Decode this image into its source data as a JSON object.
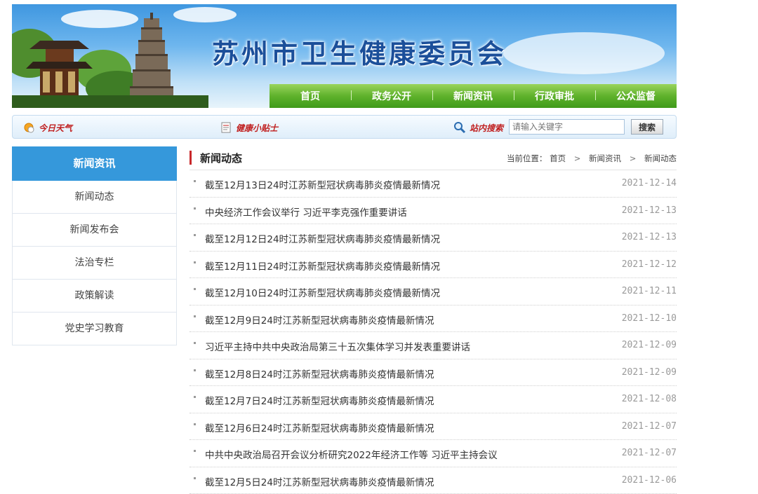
{
  "header": {
    "site_title": "苏州市卫生健康委员会",
    "nav": [
      "首页",
      "政务公开",
      "新闻资讯",
      "行政审批",
      "公众监督"
    ]
  },
  "toolbar": {
    "weather_label": "今日天气",
    "health_tips_label": "健康小贴士",
    "site_search_label": "站内搜索",
    "search_placeholder": "请输入关键字",
    "search_button": "搜索"
  },
  "sidebar": {
    "title": "新闻资讯",
    "items": [
      "新闻动态",
      "新闻发布会",
      "法治专栏",
      "政策解读",
      "党史学习教育"
    ]
  },
  "main": {
    "section_title": "新闻动态",
    "breadcrumb_prefix": "当前位置：",
    "breadcrumb": [
      "首页",
      "新闻资讯",
      "新闻动态"
    ],
    "news": [
      {
        "title": "截至12月13日24时江苏新型冠状病毒肺炎疫情最新情况",
        "date": "2021-12-14"
      },
      {
        "title": "中央经济工作会议举行 习近平李克强作重要讲话",
        "date": "2021-12-13"
      },
      {
        "title": "截至12月12日24时江苏新型冠状病毒肺炎疫情最新情况",
        "date": "2021-12-13"
      },
      {
        "title": "截至12月11日24时江苏新型冠状病毒肺炎疫情最新情况",
        "date": "2021-12-12"
      },
      {
        "title": "截至12月10日24时江苏新型冠状病毒肺炎疫情最新情况",
        "date": "2021-12-11"
      },
      {
        "title": "截至12月9日24时江苏新型冠状病毒肺炎疫情最新情况",
        "date": "2021-12-10"
      },
      {
        "title": "习近平主持中共中央政治局第三十五次集体学习并发表重要讲话",
        "date": "2021-12-09"
      },
      {
        "title": "截至12月8日24时江苏新型冠状病毒肺炎疫情最新情况",
        "date": "2021-12-09"
      },
      {
        "title": "截至12月7日24时江苏新型冠状病毒肺炎疫情最新情况",
        "date": "2021-12-08"
      },
      {
        "title": "截至12月6日24时江苏新型冠状病毒肺炎疫情最新情况",
        "date": "2021-12-07"
      },
      {
        "title": "中共中央政治局召开会议分析研究2022年经济工作等 习近平主持会议",
        "date": "2021-12-07"
      },
      {
        "title": "截至12月5日24时江苏新型冠状病毒肺炎疫情最新情况",
        "date": "2021-12-06"
      }
    ]
  }
}
